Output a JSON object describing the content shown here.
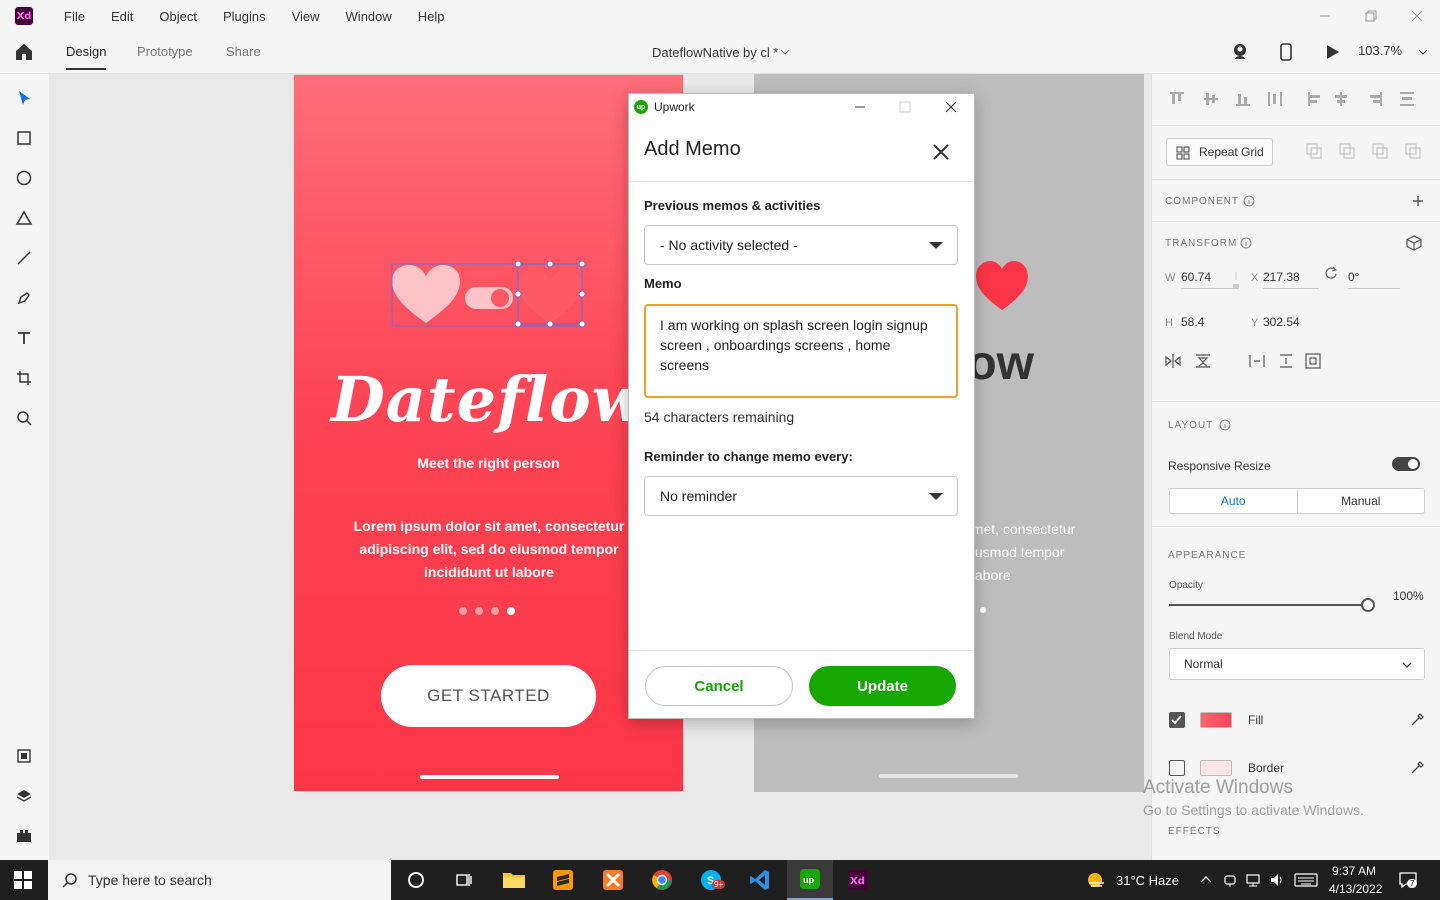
{
  "menubar": {
    "app_logo": "Xd",
    "items": [
      "File",
      "Edit",
      "Object",
      "Plugins",
      "View",
      "Window",
      "Help"
    ]
  },
  "toolbar": {
    "tabs": [
      "Design",
      "Prototype",
      "Share"
    ],
    "active_tab": "Design",
    "doc_title": "DateflowNative by cl *",
    "zoom": "103.7%"
  },
  "artboard": {
    "brand": "Dateflow",
    "tagline": "Meet the right person",
    "lorem": "Lorem ipsum dolor sit amet, consectetur adipiscing elit, sed do eiusmod tempor incididunt ut labore",
    "button": "GET STARTED",
    "accent": "#fd4555"
  },
  "artboard2": {
    "title_fragment": "low",
    "lorem_lines": [
      "amet, consectetur",
      "eiusmod tempor",
      "t labore"
    ]
  },
  "dialog": {
    "app_name": "Upwork",
    "title": "Add Memo",
    "prev_label": "Previous memos & activities",
    "prev_value": "- No activity selected -",
    "memo_label": "Memo",
    "memo_value": "I am working on splash screen login signup screen , onboardings screens , home screens",
    "remaining": "54 characters remaining",
    "reminder_label": "Reminder to change memo every:",
    "reminder_value": "No reminder",
    "cancel": "Cancel",
    "update": "Update",
    "brand_color": "#14a800",
    "focus_color": "#f0a028"
  },
  "panel": {
    "repeat_grid": "Repeat Grid",
    "component": "COMPONENT",
    "transform": "TRANSFORM",
    "w_label": "W",
    "w": "60.74",
    "x_label": "X",
    "x": "217.38",
    "rot": "0°",
    "h_label": "H",
    "h": "58.4",
    "y_label": "Y",
    "y": "302.54",
    "layout": "LAYOUT",
    "responsive": "Responsive Resize",
    "auto": "Auto",
    "manual": "Manual",
    "appearance": "APPEARANCE",
    "opacity_label": "Opacity",
    "opacity": "100%",
    "blend_label": "Blend Mode",
    "blend": "Normal",
    "fill": "Fill",
    "fill_color": "#fb6670",
    "border": "Border",
    "border_color": "#fde6e6",
    "effects": "EFFECTS"
  },
  "watermark": {
    "line1": "Activate Windows",
    "line2": "Go to Settings to activate Windows."
  },
  "taskbar": {
    "search_placeholder": "Type here to search",
    "weather": "31°C  Haze",
    "time": "9:37 AM",
    "date": "4/13/2022",
    "notif_count": "7",
    "skype_badge": "9+"
  }
}
